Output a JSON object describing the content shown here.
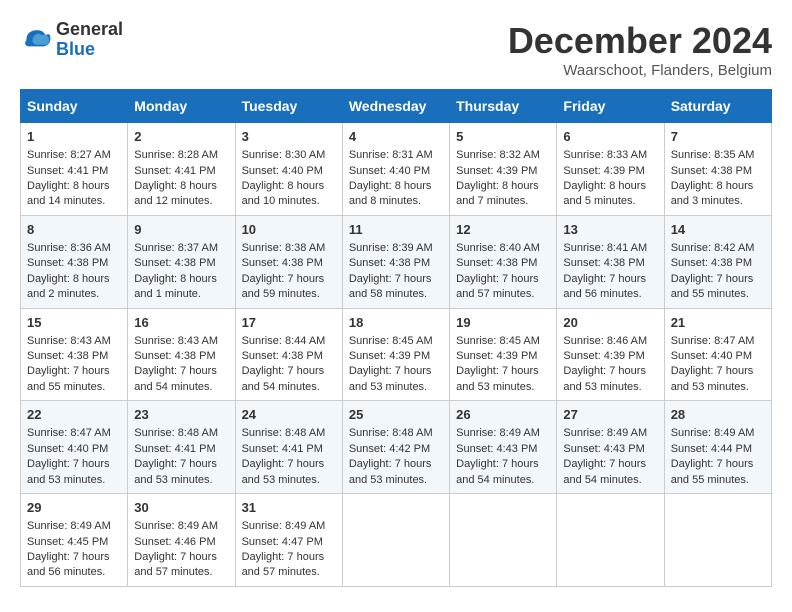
{
  "logo": {
    "line1": "General",
    "line2": "Blue"
  },
  "header": {
    "month": "December 2024",
    "location": "Waarschoot, Flanders, Belgium"
  },
  "weekdays": [
    "Sunday",
    "Monday",
    "Tuesday",
    "Wednesday",
    "Thursday",
    "Friday",
    "Saturday"
  ],
  "weeks": [
    [
      {
        "day": 1,
        "sunrise": "8:27 AM",
        "sunset": "4:41 PM",
        "daylight": "8 hours and 14 minutes."
      },
      {
        "day": 2,
        "sunrise": "8:28 AM",
        "sunset": "4:41 PM",
        "daylight": "8 hours and 12 minutes."
      },
      {
        "day": 3,
        "sunrise": "8:30 AM",
        "sunset": "4:40 PM",
        "daylight": "8 hours and 10 minutes."
      },
      {
        "day": 4,
        "sunrise": "8:31 AM",
        "sunset": "4:40 PM",
        "daylight": "8 hours and 8 minutes."
      },
      {
        "day": 5,
        "sunrise": "8:32 AM",
        "sunset": "4:39 PM",
        "daylight": "8 hours and 7 minutes."
      },
      {
        "day": 6,
        "sunrise": "8:33 AM",
        "sunset": "4:39 PM",
        "daylight": "8 hours and 5 minutes."
      },
      {
        "day": 7,
        "sunrise": "8:35 AM",
        "sunset": "4:38 PM",
        "daylight": "8 hours and 3 minutes."
      }
    ],
    [
      {
        "day": 8,
        "sunrise": "8:36 AM",
        "sunset": "4:38 PM",
        "daylight": "8 hours and 2 minutes."
      },
      {
        "day": 9,
        "sunrise": "8:37 AM",
        "sunset": "4:38 PM",
        "daylight": "8 hours and 1 minute."
      },
      {
        "day": 10,
        "sunrise": "8:38 AM",
        "sunset": "4:38 PM",
        "daylight": "7 hours and 59 minutes."
      },
      {
        "day": 11,
        "sunrise": "8:39 AM",
        "sunset": "4:38 PM",
        "daylight": "7 hours and 58 minutes."
      },
      {
        "day": 12,
        "sunrise": "8:40 AM",
        "sunset": "4:38 PM",
        "daylight": "7 hours and 57 minutes."
      },
      {
        "day": 13,
        "sunrise": "8:41 AM",
        "sunset": "4:38 PM",
        "daylight": "7 hours and 56 minutes."
      },
      {
        "day": 14,
        "sunrise": "8:42 AM",
        "sunset": "4:38 PM",
        "daylight": "7 hours and 55 minutes."
      }
    ],
    [
      {
        "day": 15,
        "sunrise": "8:43 AM",
        "sunset": "4:38 PM",
        "daylight": "7 hours and 55 minutes."
      },
      {
        "day": 16,
        "sunrise": "8:43 AM",
        "sunset": "4:38 PM",
        "daylight": "7 hours and 54 minutes."
      },
      {
        "day": 17,
        "sunrise": "8:44 AM",
        "sunset": "4:38 PM",
        "daylight": "7 hours and 54 minutes."
      },
      {
        "day": 18,
        "sunrise": "8:45 AM",
        "sunset": "4:39 PM",
        "daylight": "7 hours and 53 minutes."
      },
      {
        "day": 19,
        "sunrise": "8:45 AM",
        "sunset": "4:39 PM",
        "daylight": "7 hours and 53 minutes."
      },
      {
        "day": 20,
        "sunrise": "8:46 AM",
        "sunset": "4:39 PM",
        "daylight": "7 hours and 53 minutes."
      },
      {
        "day": 21,
        "sunrise": "8:47 AM",
        "sunset": "4:40 PM",
        "daylight": "7 hours and 53 minutes."
      }
    ],
    [
      {
        "day": 22,
        "sunrise": "8:47 AM",
        "sunset": "4:40 PM",
        "daylight": "7 hours and 53 minutes."
      },
      {
        "day": 23,
        "sunrise": "8:48 AM",
        "sunset": "4:41 PM",
        "daylight": "7 hours and 53 minutes."
      },
      {
        "day": 24,
        "sunrise": "8:48 AM",
        "sunset": "4:41 PM",
        "daylight": "7 hours and 53 minutes."
      },
      {
        "day": 25,
        "sunrise": "8:48 AM",
        "sunset": "4:42 PM",
        "daylight": "7 hours and 53 minutes."
      },
      {
        "day": 26,
        "sunrise": "8:49 AM",
        "sunset": "4:43 PM",
        "daylight": "7 hours and 54 minutes."
      },
      {
        "day": 27,
        "sunrise": "8:49 AM",
        "sunset": "4:43 PM",
        "daylight": "7 hours and 54 minutes."
      },
      {
        "day": 28,
        "sunrise": "8:49 AM",
        "sunset": "4:44 PM",
        "daylight": "7 hours and 55 minutes."
      }
    ],
    [
      {
        "day": 29,
        "sunrise": "8:49 AM",
        "sunset": "4:45 PM",
        "daylight": "7 hours and 56 minutes."
      },
      {
        "day": 30,
        "sunrise": "8:49 AM",
        "sunset": "4:46 PM",
        "daylight": "7 hours and 57 minutes."
      },
      {
        "day": 31,
        "sunrise": "8:49 AM",
        "sunset": "4:47 PM",
        "daylight": "7 hours and 57 minutes."
      },
      null,
      null,
      null,
      null
    ]
  ],
  "labels": {
    "sunrise": "Sunrise:",
    "sunset": "Sunset:",
    "daylight": "Daylight:"
  }
}
